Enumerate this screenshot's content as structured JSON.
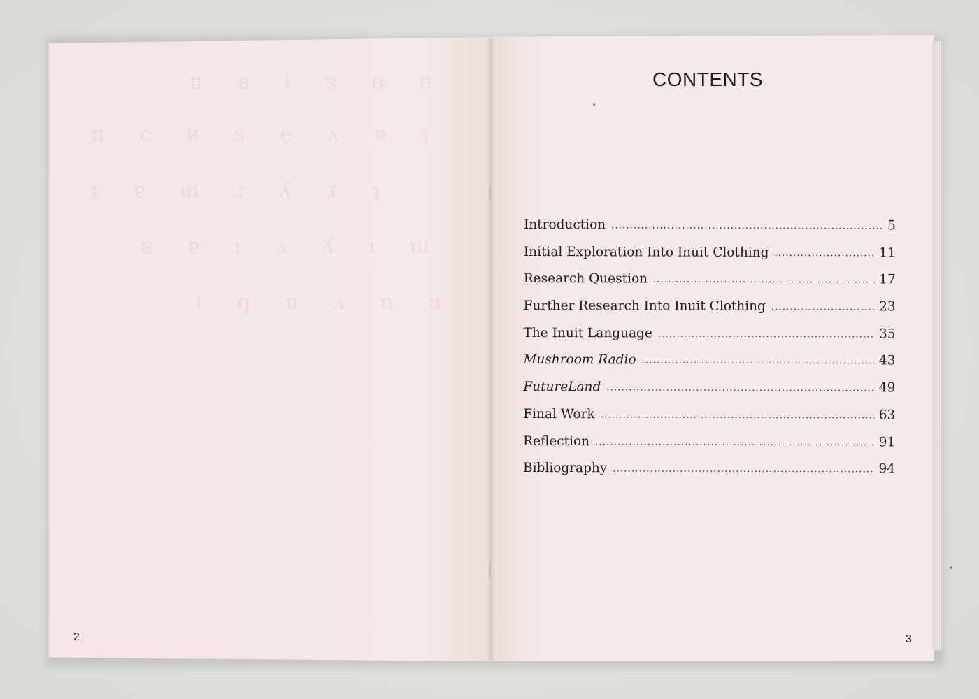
{
  "document": {
    "left_page_number": "2",
    "right_page_number": "3",
    "contents_heading": "CONTENTS",
    "toc": [
      {
        "title": "Introduction",
        "page": "5",
        "italic": false
      },
      {
        "title": "Initial Exploration Into Inuit Clothing",
        "page": "11",
        "italic": false
      },
      {
        "title": "Research Question",
        "page": "17",
        "italic": false
      },
      {
        "title": "Further Research Into Inuit Clothing",
        "page": "23",
        "italic": false
      },
      {
        "title": "The Inuit Language",
        "page": "35",
        "italic": false
      },
      {
        "title": "Mushroom Radio",
        "page": "43",
        "italic": true
      },
      {
        "title": "FutureLand",
        "page": "49",
        "italic": true
      },
      {
        "title": "Final Work",
        "page": "63",
        "italic": false
      },
      {
        "title": "Reflection",
        "page": "91",
        "italic": false
      },
      {
        "title": "Bibliography",
        "page": "94",
        "italic": false
      }
    ]
  },
  "colors": {
    "paper": "#f5e9e7",
    "text": "#1e1e1e",
    "background": "#dfe1dd"
  }
}
